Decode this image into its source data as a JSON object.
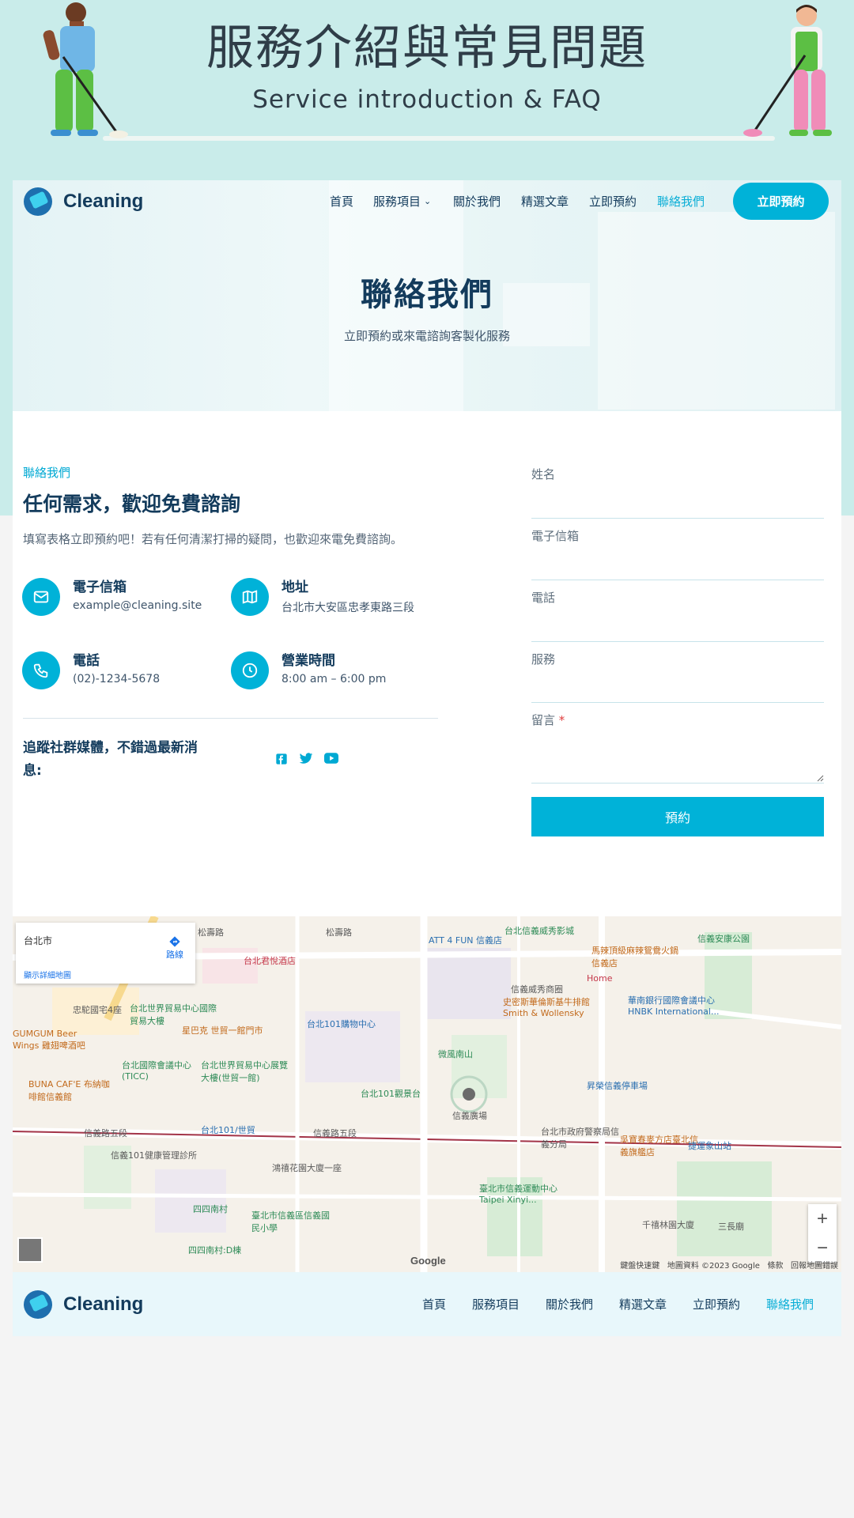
{
  "banner": {
    "title": "服務介紹與常見問題",
    "subtitle": "Service introduction & FAQ"
  },
  "header": {
    "logo_text": "Cleaning",
    "nav": [
      "首頁",
      "服務項目",
      "關於我們",
      "精選文章",
      "立即預約",
      "聯絡我們"
    ],
    "active_nav": "聯絡我們",
    "cta_label": "立即預約"
  },
  "hero": {
    "title": "聯絡我們",
    "subtitle": "立即預約或來電諮詢客製化服務"
  },
  "contact": {
    "eyebrow": "聯絡我們",
    "title": "任何需求，歡迎免費諮詢",
    "description": "填寫表格立即預約吧！若有任何清潔打掃的疑問，也歡迎來電免費諮詢。",
    "items": [
      {
        "label": "電子信箱",
        "value": "example@cleaning.site",
        "icon": "mail-icon"
      },
      {
        "label": "地址",
        "value": "台北市大安區忠孝東路三段",
        "icon": "map-icon"
      },
      {
        "label": "電話",
        "value": "(02)-1234-5678",
        "icon": "phone-icon"
      },
      {
        "label": "營業時間",
        "value": "8:00 am – 6:00 pm",
        "icon": "clock-icon"
      }
    ],
    "social_title": "追蹤社群媒體，不錯過最新消息:",
    "social_icons": [
      "facebook-icon",
      "twitter-icon",
      "youtube-icon"
    ]
  },
  "form": {
    "name_label": "姓名",
    "email_label": "電子信箱",
    "phone_label": "電話",
    "service_label": "服務",
    "message_label": "留言",
    "required_mark": "*",
    "submit_label": "預約"
  },
  "map": {
    "place": "台北市",
    "directions_label": "路線",
    "details_link": "顯示詳細地圖",
    "labels": [
      "松壽路",
      "松壽路",
      "ATT 4 FUN 信義店",
      "台北信義威秀影城",
      "馬辣頂級麻辣鴛鴦火鍋信義店",
      "信義安康公園",
      "台北君悅酒店",
      "信義威秀商圈",
      "Home",
      "史密斯華倫斯基牛排館Smith & Wollensky",
      "華南銀行國際會議中心 HNBK International...",
      "忠駝國宅4座",
      "台北世界貿易中心國際貿易大樓",
      "星巴克 世貿一館門市",
      "台北101購物中心",
      "GUMGUM Beer Wings 雞翅啤酒吧",
      "台北國際會議中心(TICC)",
      "台北世界貿易中心展覽大樓(世貿一館)",
      "微風南山",
      "BUNA CAF'E 布納咖啡館信義館",
      "台北101觀景台",
      "信義廣場",
      "昇榮信義停車場",
      "台北101/世貿",
      "信義路五段",
      "信義路五段",
      "台北市政府警察局信義分局",
      "吳寶春麥方店臺北信義旗艦店",
      "信義101健康管理診所",
      "捷運象山站",
      "鴻禧花園大廈一座",
      "臺北市信義運動中心 Taipei Xinyi...",
      "臺北市信義區信義國民小學",
      "四四南村",
      "四四南村:D棟",
      "千禧林園大廈",
      "三長廟",
      "Google",
      "鍵盤快速鍵",
      "地圖資料 ©2023 Google",
      "條款",
      "回報地圖錯誤"
    ],
    "zoom_in": "+",
    "zoom_out": "−"
  },
  "footer": {
    "logo_text": "Cleaning",
    "nav": [
      "首頁",
      "服務項目",
      "關於我們",
      "精選文章",
      "立即預約",
      "聯絡我們"
    ],
    "active_nav": "聯絡我們"
  },
  "colors": {
    "accent": "#00b2d8",
    "heading": "#133b5c",
    "banner_bg": "#c9ecea",
    "footer_bg": "#e8f7fb"
  }
}
